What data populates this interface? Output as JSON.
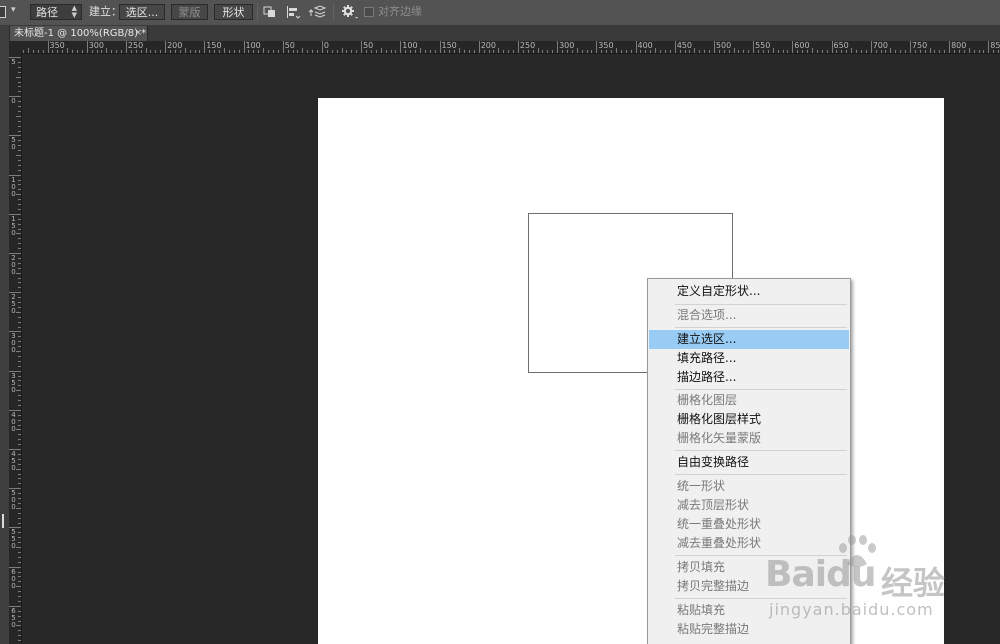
{
  "options_bar": {
    "tool_preset_icon": "path-tool-preset-icon",
    "mode_select": "路径",
    "make_label": "建立：",
    "selection_button": "选区...",
    "mask_button": "蒙版",
    "shape_button": "形状",
    "path_operations_icon": "path-operations-icon",
    "path_alignment_icon": "path-alignment-icon",
    "path_arrangement_icon": "path-arrangement-icon",
    "settings_icon": "gear-icon",
    "align_edges_label": "对齐边缘"
  },
  "document_tab": {
    "title": "未标题-1 @ 100%(RGB/8) *",
    "close": "×"
  },
  "rulers": {
    "horizontal_labels": [
      "350",
      "300",
      "250",
      "200",
      "150",
      "100",
      "50",
      "0",
      "50",
      "100",
      "150",
      "200",
      "250",
      "300",
      "350",
      "400",
      "450",
      "500",
      "550",
      "600",
      "650",
      "700",
      "750",
      "800",
      "850"
    ],
    "vertical_labels": [
      "5",
      "0",
      "50",
      "100",
      "150",
      "200",
      "250",
      "300",
      "350",
      "400",
      "450",
      "500",
      "550",
      "600",
      "650"
    ]
  },
  "context_menu": {
    "items": [
      {
        "label": "定义自定形状...",
        "enabled": true
      },
      {
        "label": "混合选项...",
        "enabled": false
      },
      {
        "label": "建立选区...",
        "enabled": true,
        "highlighted": true
      },
      {
        "label": "填充路径...",
        "enabled": true
      },
      {
        "label": "描边路径...",
        "enabled": true
      },
      {
        "label": "栅格化图层",
        "enabled": false
      },
      {
        "label": "栅格化图层样式",
        "enabled": true
      },
      {
        "label": "栅格化矢量蒙版",
        "enabled": false
      },
      {
        "label": "自由变换路径",
        "enabled": true
      },
      {
        "label": "统一形状",
        "enabled": false
      },
      {
        "label": "减去顶层形状",
        "enabled": false
      },
      {
        "label": "统一重叠处形状",
        "enabled": false
      },
      {
        "label": "减去重叠处形状",
        "enabled": false
      },
      {
        "label": "拷贝填充",
        "enabled": false
      },
      {
        "label": "拷贝完整描边",
        "enabled": false
      },
      {
        "label": "粘贴填充",
        "enabled": false
      },
      {
        "label": "粘贴完整描边",
        "enabled": false
      }
    ]
  },
  "watermark": {
    "logo": "Baidu",
    "cn": "经验",
    "url": "jingyan.baidu.com"
  },
  "colors": {
    "workspace": "#282828",
    "options_bar": "#535353",
    "menu_bg": "#f0f0f0",
    "menu_highlight": "#99ccf4",
    "canvas": "#ffffff"
  }
}
